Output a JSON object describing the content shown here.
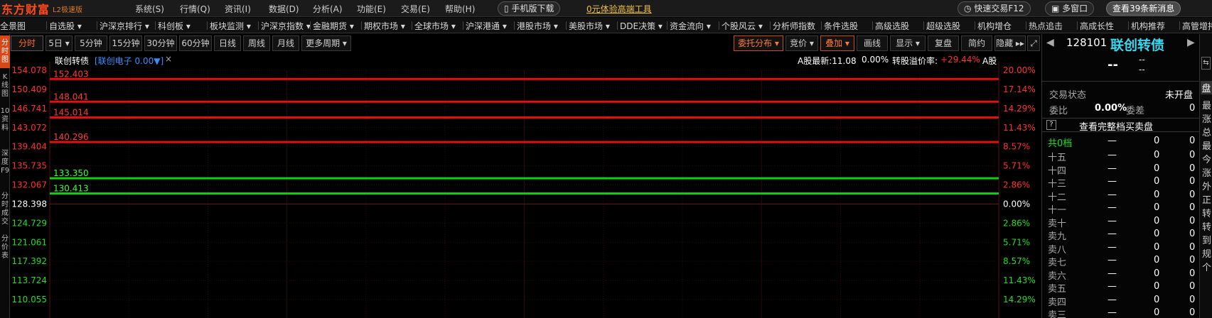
{
  "app": {
    "brand": "东方财富",
    "version": "L2极速版"
  },
  "menu": [
    "系统(S)",
    "行情(Q)",
    "资讯(I)",
    "数据(D)",
    "分析(A)",
    "功能(E)",
    "交易(E)",
    "帮助(H)"
  ],
  "promo": {
    "mobile": "手机版下载",
    "free_tool": "0元体验高端工具"
  },
  "titlebar_right": {
    "quick_trade": "快速交易F12",
    "multi_window": "多窗口",
    "news": "查看39条新消息"
  },
  "nav": [
    "全景图",
    "自选股",
    "沪深京排行",
    "科创板",
    "板块监测",
    "沪深京指数",
    "金融期货",
    "期权市场",
    "全球市场",
    "沪深港通",
    "港股市场",
    "美股市场",
    "DDE决策",
    "资金流向",
    "个股风云",
    "分析师指数",
    "条件选股",
    "高级选股",
    "超级选股",
    "机构增仓",
    "热点追击",
    "高成长性",
    "机构推荐",
    "高管增持"
  ],
  "left_tabs": [
    "分时图",
    "K线图",
    "10资料",
    "深度F9",
    "分时成交",
    "分价表"
  ],
  "chart_toolbar": {
    "periods": [
      "分时",
      "5日",
      "5分钟",
      "15分钟",
      "30分钟",
      "60分钟",
      "日线",
      "周线",
      "月线",
      "更多周期"
    ],
    "right": [
      "委托分布",
      "竞价",
      "叠加",
      "画线",
      "显示",
      "复盘",
      "简约",
      "隐藏"
    ]
  },
  "chart_header": {
    "name": "联创转债",
    "overlay": "[联创电子 0.00▼]",
    "close_x": "×",
    "a_share_latest": "A股最新:11.08",
    "a_share_pct": "0.00%",
    "premium_label": "转股溢价率:",
    "premium_value": "+29.44%",
    "a_label": "A股"
  },
  "chart_data": {
    "type": "line",
    "y_left": [
      "154.078",
      "150.409",
      "146.741",
      "143.072",
      "139.404",
      "135.735",
      "132.067",
      "128.398",
      "124.729",
      "121.061",
      "117.392",
      "113.724",
      "110.055"
    ],
    "y_right": [
      "20.00%",
      "17.14%",
      "14.29%",
      "11.43%",
      "8.57%",
      "5.71%",
      "2.86%",
      "0.00%",
      "2.86%",
      "5.71%",
      "8.57%",
      "11.43%",
      "14.29%"
    ],
    "ylim": [
      110.055,
      154.078
    ],
    "grid": true,
    "pending_orders": [
      {
        "price": 152.403,
        "side": "sell"
      },
      {
        "price": 148.041,
        "side": "sell"
      },
      {
        "price": 145.014,
        "side": "sell"
      },
      {
        "price": 140.296,
        "side": "sell"
      },
      {
        "price": 133.35,
        "side": "buy"
      },
      {
        "price": 130.413,
        "side": "buy"
      }
    ],
    "colors": {
      "sell": "#e01010",
      "buy": "#10d010"
    }
  },
  "quote": {
    "code": "128101",
    "name": "联创转债",
    "price": "--",
    "chg1": "--",
    "chg2": "--",
    "status_label": "交易状态",
    "status_value": "未开盘",
    "ratio_label": "委比",
    "ratio_value": "0.00%",
    "diff_label": "委差",
    "diff_value": "0",
    "full_book": "查看完整档买卖盘",
    "total_label": "共0档",
    "levels": [
      "十五",
      "十四",
      "十三",
      "十二",
      "十一",
      "卖十",
      "卖九",
      "卖八",
      "卖七",
      "卖六",
      "卖五",
      "卖四",
      "卖三"
    ],
    "dash": "—",
    "zero": "0"
  },
  "right_strip": [
    "最",
    "涨",
    "总",
    "最",
    "今",
    "涨",
    "外",
    "正",
    "转",
    "转",
    "到",
    "规",
    "个"
  ],
  "right_strip_top": [
    "盘"
  ]
}
